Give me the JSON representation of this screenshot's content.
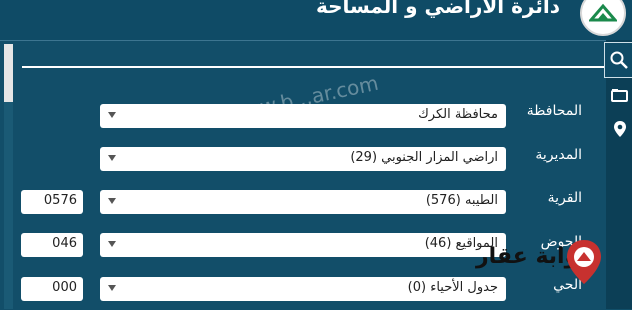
{
  "header": {
    "title": "دائرة الاراضي و المساحة"
  },
  "brand": {
    "text": "بوابة عقار"
  },
  "watermark": {
    "text": "© www.b...ar.com"
  },
  "icons": {
    "search": "search-icon",
    "folder": "folder-icon",
    "location": "location-pin-icon"
  },
  "form": {
    "governorate": {
      "label": "المحافظة",
      "value": "محافظة الكرك"
    },
    "directorate": {
      "label": "المديرية",
      "value": "اراضي المزار الجنوبي (29)"
    },
    "village": {
      "label": "القرية",
      "value": "الطيبه (576)",
      "code": "0576"
    },
    "basin": {
      "label": "الحوض",
      "value": "المواقيع (46)",
      "code": "046"
    },
    "neighborhood": {
      "label": "الحي",
      "value": "جدول الأحياء (0)",
      "code": "000"
    }
  },
  "colors": {
    "background": "#114f69",
    "accent": "#ffffff",
    "brand_red": "#c7312f"
  }
}
